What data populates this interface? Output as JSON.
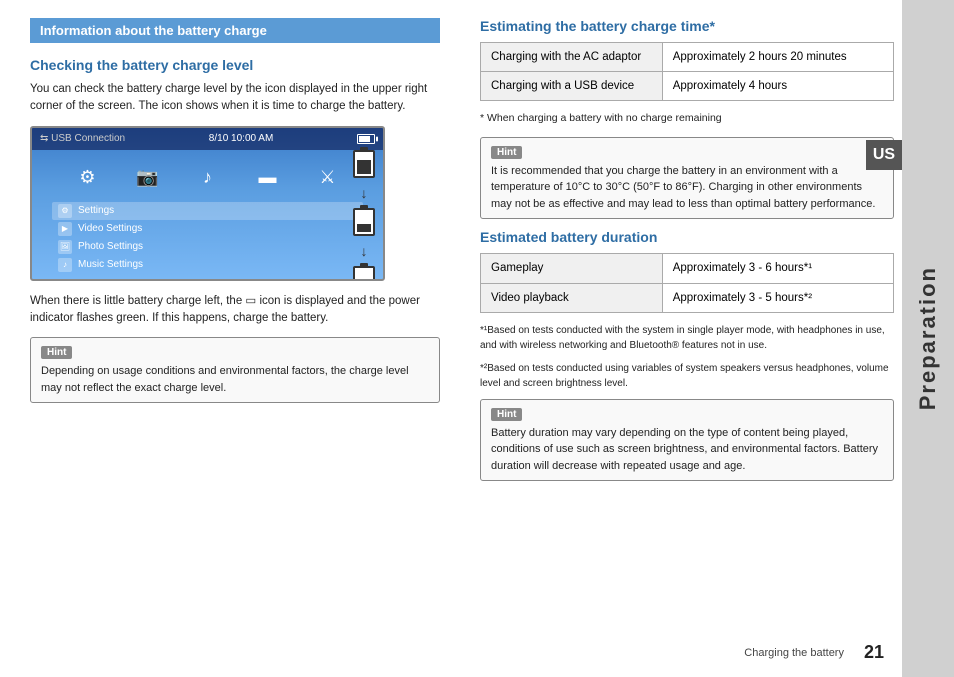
{
  "page": {
    "sidebar_us": "US",
    "sidebar_label": "Preparation",
    "footer_text": "Charging the battery",
    "page_number": "21"
  },
  "left": {
    "info_header": "Information about the battery charge",
    "section_title": "Checking the battery charge level",
    "body_text1": "You can check the battery charge level by the icon displayed in the upper right corner of the screen. The icon shows when it is time to charge the battery.",
    "screen_caption": "When there is little battery charge left, the ▭ icon is displayed and the power indicator flashes green. If this happens, charge the battery.",
    "hint_label": "Hint",
    "hint_text": "Depending on usage conditions and environmental factors, the charge level may not reflect the exact charge level.",
    "psp": {
      "usb_text": "⇆ USB Connection",
      "date_time": "8/10  10:00 AM",
      "menu_items": [
        {
          "label": "Settings",
          "icon": "⚙"
        },
        {
          "label": "Video Settings",
          "icon": "▶"
        },
        {
          "label": "Photo Settings",
          "icon": "🖼"
        },
        {
          "label": "Music Settings",
          "icon": "♫"
        }
      ],
      "top_icons": [
        {
          "icon": "⚙",
          "label": ""
        },
        {
          "icon": "📷",
          "label": ""
        },
        {
          "icon": "♫",
          "label": ""
        },
        {
          "icon": "■",
          "label": ""
        },
        {
          "icon": "▶",
          "label": ""
        }
      ]
    }
  },
  "right": {
    "section_title": "Estimating the battery charge time*",
    "charge_table": {
      "rows": [
        {
          "label": "Charging with the AC adaptor",
          "value": "Approximately 2 hours 20 minutes"
        },
        {
          "label": "Charging with a USB device",
          "value": "Approximately 4 hours"
        }
      ]
    },
    "asterisk_note": "* When charging a battery with no charge remaining",
    "hint_label": "Hint",
    "hint_text": "It is recommended that you charge the battery in an environment with a temperature of 10°C to 30°C (50°F to 86°F). Charging in other environments may not be as effective and may lead to less than optimal battery performance.",
    "section_title2": "Estimated battery duration",
    "duration_table": {
      "rows": [
        {
          "label": "Gameplay",
          "value": "Approximately 3 - 6 hours*¹"
        },
        {
          "label": "Video playback",
          "value": "Approximately 3 - 5 hours*²"
        }
      ]
    },
    "footnote1": "*¹Based on tests conducted with the system in single player mode, with headphones in use, and with wireless networking and Bluetooth® features not in use.",
    "footnote2": "*²Based on tests conducted using variables of system speakers versus headphones, volume level and screen brightness level.",
    "hint_label2": "Hint",
    "hint_text2": "Battery duration may vary depending on the type of content being played, conditions of use such as screen brightness, and environmental factors. Battery duration will decrease with repeated usage and age."
  }
}
